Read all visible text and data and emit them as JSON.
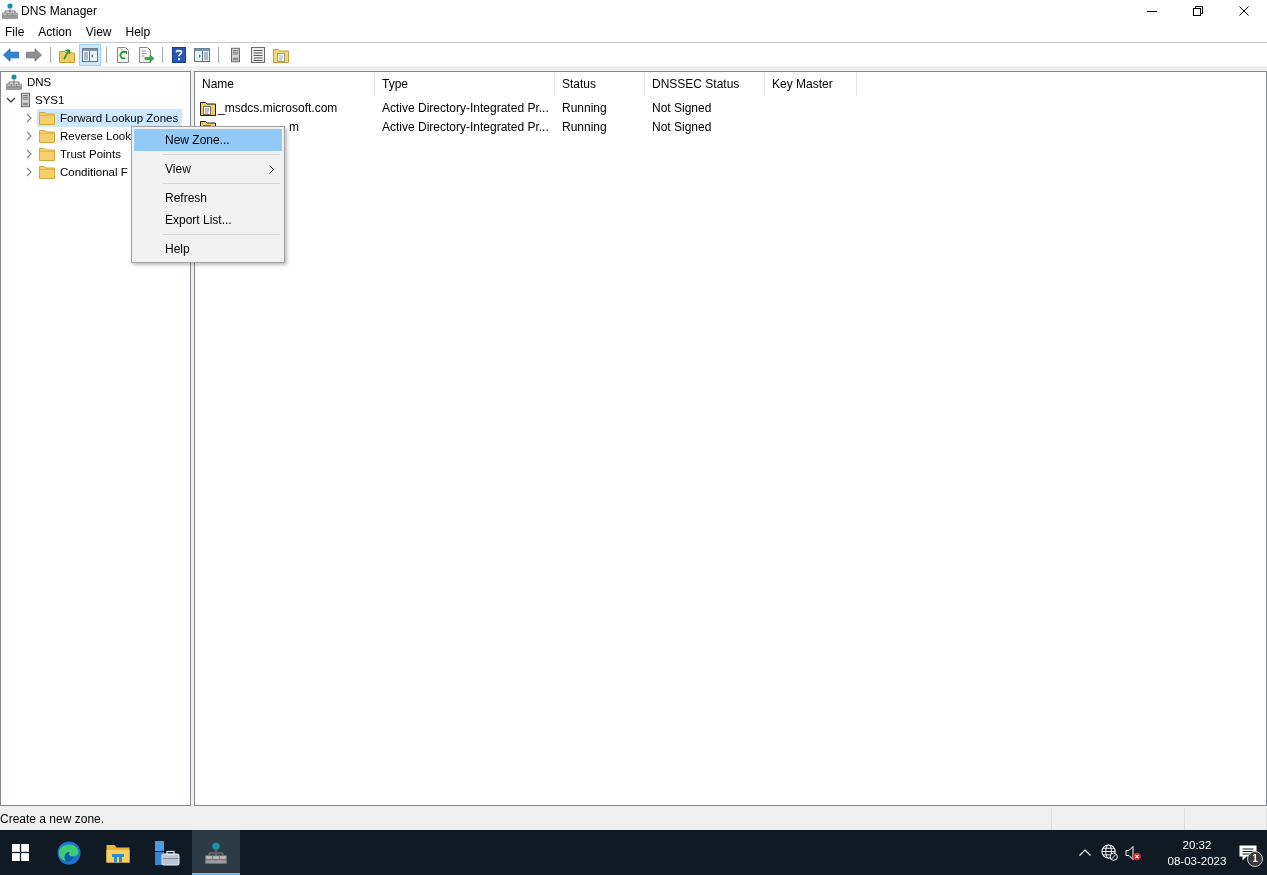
{
  "window": {
    "title": "DNS Manager"
  },
  "menu_bar": [
    "File",
    "Action",
    "View",
    "Help"
  ],
  "toolbar": [
    {
      "buttons": [
        {
          "kind": "back",
          "pressed": false,
          "disabled": false
        },
        {
          "kind": "forward",
          "pressed": false,
          "disabled": true
        }
      ]
    },
    {
      "buttons": [
        {
          "kind": "up",
          "pressed": false,
          "disabled": false
        },
        {
          "kind": "console-tree",
          "pressed": true,
          "disabled": false
        }
      ]
    },
    {
      "buttons": [
        {
          "kind": "refresh",
          "pressed": false,
          "disabled": false
        },
        {
          "kind": "export",
          "pressed": false,
          "disabled": false
        }
      ]
    },
    {
      "buttons": [
        {
          "kind": "help",
          "pressed": false,
          "disabled": false
        },
        {
          "kind": "action-pane",
          "pressed": false,
          "disabled": false
        }
      ]
    },
    {
      "buttons": [
        {
          "kind": "server",
          "pressed": false,
          "disabled": false
        },
        {
          "kind": "list",
          "pressed": false,
          "disabled": false
        },
        {
          "kind": "zones",
          "pressed": false,
          "disabled": false
        }
      ]
    }
  ],
  "tree": [
    {
      "label": "DNS",
      "kind": "root",
      "selected": false,
      "children": [
        {
          "label": "SYS1",
          "kind": "server",
          "expanded": true,
          "selected": false,
          "children": [
            {
              "label": "Forward Lookup Zones",
              "kind": "folder",
              "expanded": false,
              "selected": true
            },
            {
              "label": "Reverse Look",
              "kind": "folder",
              "expanded": false,
              "selected": false
            },
            {
              "label": "Trust Points",
              "kind": "folder",
              "expanded": false,
              "selected": false
            },
            {
              "label": "Conditional F",
              "kind": "folder",
              "expanded": false,
              "selected": false
            }
          ]
        }
      ]
    }
  ],
  "list": {
    "columns": [
      "Name",
      "Type",
      "Status",
      "DNSSEC Status",
      "Key Master"
    ],
    "rows": [
      {
        "cells": [
          "_msdcs.microsoft.com",
          "Active Directory-Integrated Pr...",
          "Running",
          "Not Signed"
        ],
        "selected": false,
        "under_menu": false
      },
      {
        "cells": [
          "m",
          "Active Directory-Integrated Pr...",
          "Running",
          "Not Signed"
        ],
        "selected": false,
        "under_menu": true
      }
    ]
  },
  "context_menu": {
    "items": [
      {
        "kind": "command",
        "label": "New Zone...",
        "selected": true,
        "submenu": false
      },
      {
        "kind": "separator"
      },
      {
        "kind": "command",
        "label": "View",
        "selected": false,
        "submenu": true
      },
      {
        "kind": "separator"
      },
      {
        "kind": "command",
        "label": "Refresh",
        "selected": false,
        "submenu": false
      },
      {
        "kind": "command",
        "label": "Export List...",
        "selected": false,
        "submenu": false
      },
      {
        "kind": "separator"
      },
      {
        "kind": "command",
        "label": "Help",
        "selected": false,
        "submenu": false
      }
    ]
  },
  "status_bar": {
    "text": "Create a new zone."
  },
  "taskbar": {
    "apps": [
      {
        "kind": "browser",
        "active": false
      },
      {
        "kind": "explorer",
        "active": false
      },
      {
        "kind": "server-manager",
        "active": false
      },
      {
        "kind": "dns",
        "active": true
      }
    ],
    "tray": {
      "time": "20:32",
      "date": "08-03-2023",
      "notification_count": "1"
    }
  }
}
